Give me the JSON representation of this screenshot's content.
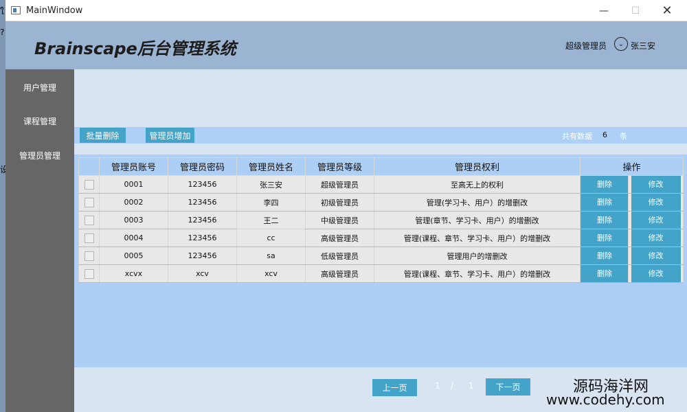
{
  "window": {
    "title": "MainWindow",
    "minimize": "—",
    "maximize": "☐",
    "close": "✕"
  },
  "background_fragments": [
    "ใ",
    "?",
    "设"
  ],
  "header": {
    "brand": "Brainscape后台管理系统",
    "role": "超级管理员",
    "user_name": "张三安",
    "user_icon": "chevron-down-icon"
  },
  "sidebar": {
    "items": [
      "用户管理",
      "课程管理",
      "管理员管理"
    ]
  },
  "toolbar": {
    "batch_delete": "批量删除",
    "add_admin": "管理员增加",
    "count_label": "共有数据",
    "count_value": "6",
    "count_unit": "条"
  },
  "table": {
    "headers": [
      "",
      "管理员账号",
      "管理员密码",
      "管理员姓名",
      "管理员等级",
      "管理员权利",
      "操作"
    ],
    "delete_label": "删除",
    "edit_label": "修改",
    "rows": [
      [
        "0001",
        "123456",
        "张三安",
        "超级管理员",
        "至高无上的权利"
      ],
      [
        "0002",
        "123456",
        "李四",
        "初级管理员",
        "管理(学习卡、用户）的增删改"
      ],
      [
        "0003",
        "123456",
        "王二",
        "中级管理员",
        "管理(章节、学习卡、用户）的增删改"
      ],
      [
        "0004",
        "123456",
        "cc",
        "高级管理员",
        "管理(课程、章节、学习卡、用户）的增删改"
      ],
      [
        "0005",
        "123456",
        "sa",
        "低级管理员",
        "管理用户的增删改"
      ],
      [
        "xcvx",
        "xcv",
        "xcv",
        "高级管理员",
        "管理(课程、章节、学习卡、用户）的增删改"
      ]
    ]
  },
  "pager": {
    "prev": "上一页",
    "current": "1",
    "separator": "/",
    "total": "1",
    "next": "下一页"
  },
  "watermark": {
    "line1": "源码海洋网",
    "line2": "www.codehy.com"
  }
}
